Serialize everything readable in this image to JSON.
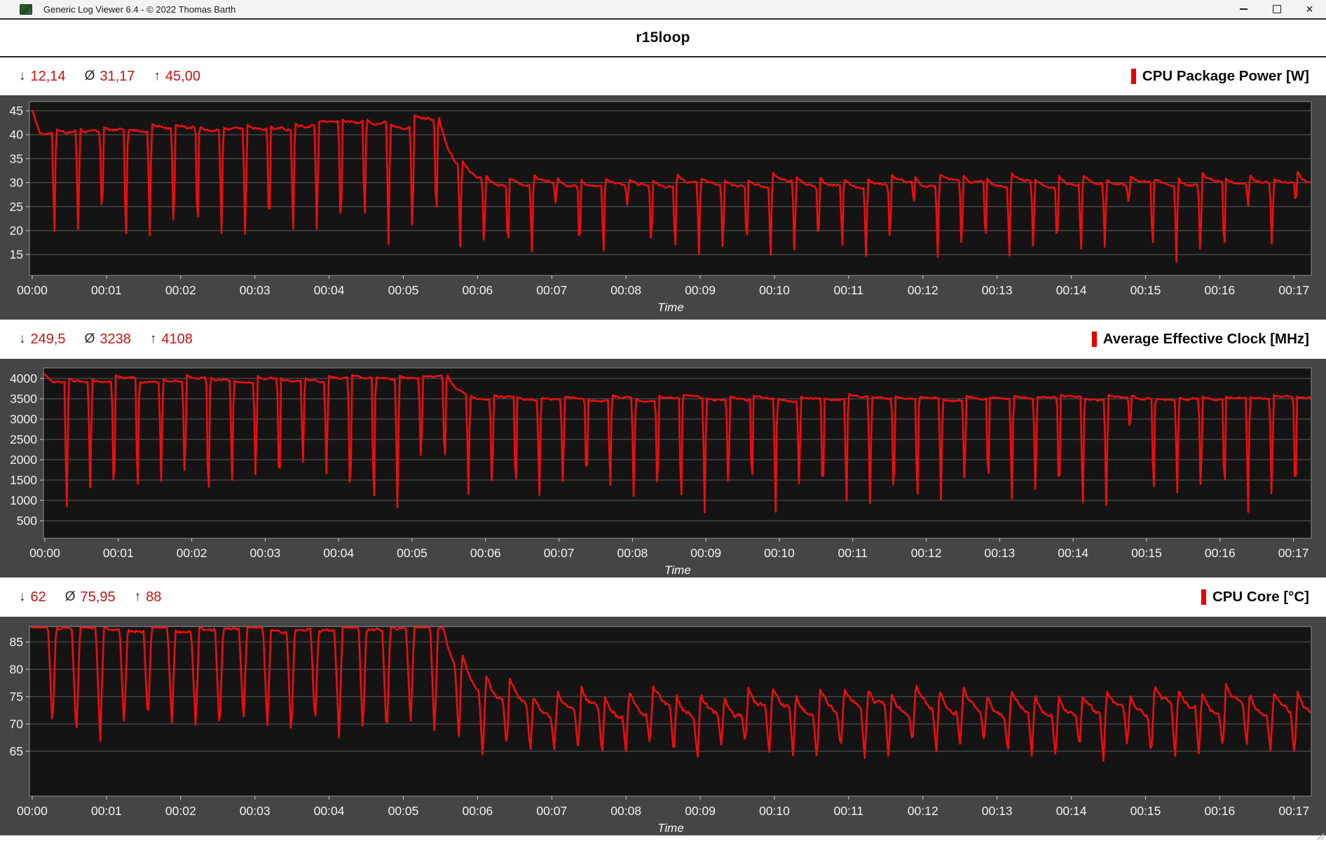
{
  "window": {
    "title": "Generic Log Viewer 6.4 - © 2022 Thomas Barth",
    "close_glyph": "✕"
  },
  "header": {
    "title": "r15loop"
  },
  "stats_icons": {
    "min": "↓",
    "avg": "Ø",
    "max": "↑"
  },
  "sections": [
    {
      "label": "CPU Package Power [W]",
      "stats": {
        "min": "12,14",
        "avg": "31,17",
        "max": "45,00"
      }
    },
    {
      "label": "Average Effective Clock [MHz]",
      "stats": {
        "min": "249,5",
        "avg": "3238",
        "max": "4108"
      }
    },
    {
      "label": "CPU Core [°C]",
      "stats": {
        "min": "62",
        "avg": "75,95",
        "max": "88"
      }
    }
  ],
  "colors": {
    "line_red": "#ee0d0d",
    "stat_value_red": "#c41414",
    "series_bar_red": "#e60000",
    "chart_container_bg": "#454545",
    "plot_bg": "#141414",
    "grid_line": "#5c5c5c",
    "plot_border": "#8d8d8d",
    "axis_text": "#f2f2f2",
    "titlebar_bg": "#f3f3f3"
  },
  "x_ticks": [
    "00:00",
    "00:01",
    "00:02",
    "00:03",
    "00:04",
    "00:05",
    "00:06",
    "00:07",
    "00:08",
    "00:09",
    "00:10",
    "00:11",
    "00:12",
    "00:13",
    "00:14",
    "00:15",
    "00:16",
    "00:17"
  ],
  "chart_data": [
    {
      "type": "line",
      "title": "CPU Package Power [W]",
      "unit": "W",
      "xlabel": "Time",
      "x_range_minutes": [
        0,
        17.2
      ],
      "y_axis": {
        "ticks": [
          45,
          40,
          35,
          30,
          25,
          20,
          15
        ]
      },
      "stats": {
        "min": 12.14,
        "avg": 31.17,
        "max": 45.0
      },
      "pattern": {
        "seed": 11,
        "period_s": 19.3,
        "phase_change_s": 329,
        "tau_s": 14,
        "start_peak": 45,
        "A": {
          "level": 40.3,
          "level_end": 42.7,
          "noise": 0.5,
          "dip_min": 14.8,
          "dip_max": 21.5,
          "dip_pow": 1.3,
          "dip_width_s": 3.2,
          "spike": 0.7,
          "spike_decay_s": 3,
          "shallow_chance": 0,
          "shallow_level": 0
        },
        "B": {
          "level": 29.7,
          "noise": 0.45,
          "dip_min": 12.3,
          "dip_max": 15.5,
          "dip_pow": 1.0,
          "dip_width_s": 3.0,
          "spike": 1.6,
          "spike_decay_s": 4,
          "shallow_chance": 0.08,
          "shallow_level": 25
        }
      }
    },
    {
      "type": "line",
      "title": "Average Effective Clock [MHz]",
      "unit": "MHz",
      "xlabel": "Time",
      "x_range_minutes": [
        0,
        17.2
      ],
      "y_axis": {
        "ticks": [
          4000,
          3500,
          3000,
          2500,
          2000,
          1500,
          1000,
          500
        ]
      },
      "stats": {
        "min": 249.5,
        "avg": 3238,
        "max": 4108
      },
      "pattern": {
        "seed": 23,
        "period_s": 19.3,
        "phase_change_s": 329,
        "tau_s": 9,
        "start_peak": 4100,
        "A": {
          "level": 3950,
          "level_end": 3980,
          "noise": 40,
          "dip_min": 480,
          "dip_max": 1750,
          "dip_pow": 1.7,
          "dip_width_s": 3.2,
          "spike": 70,
          "spike_decay_s": 3,
          "shallow_chance": 0,
          "shallow_level": 0
        },
        "B": {
          "level": 3495,
          "noise": 35,
          "dip_min": 600,
          "dip_max": 1200,
          "dip_pow": 1.5,
          "dip_width_s": 3.0,
          "spike": 60,
          "spike_decay_s": 3,
          "shallow_chance": 0.06,
          "shallow_level": 2600
        }
      }
    },
    {
      "type": "line",
      "title": "CPU Core [°C]",
      "unit": "°C",
      "xlabel": "Time",
      "x_range_minutes": [
        0,
        17.2
      ],
      "y_axis": {
        "ticks": [
          85,
          80,
          75,
          70,
          65
        ]
      },
      "stats": {
        "min": 62,
        "avg": 75.95,
        "max": 88
      },
      "pattern": {
        "seed": 5,
        "period_s": 19.3,
        "phase_change_s": 330,
        "tau_s": 17,
        "start_peak": 88,
        "A": {
          "level": 87.4,
          "level_end": 87.9,
          "noise": 0.5,
          "dip_min": 66.5,
          "dip_max": 70.5,
          "dip_pow": 1.2,
          "dip_width_s": 6.5,
          "spike": 0.2,
          "spike_decay_s": 2,
          "shallow_chance": 0,
          "shallow_level": 0
        },
        "B": {
          "level": 71.9,
          "noise": 0.8,
          "dip_min": 63,
          "dip_max": 66.5,
          "dip_pow": 1.2,
          "dip_width_s": 5.5,
          "spike": 4.3,
          "spike_decay_s": 6.5,
          "shallow_chance": 0,
          "shallow_level": 0
        }
      }
    }
  ]
}
